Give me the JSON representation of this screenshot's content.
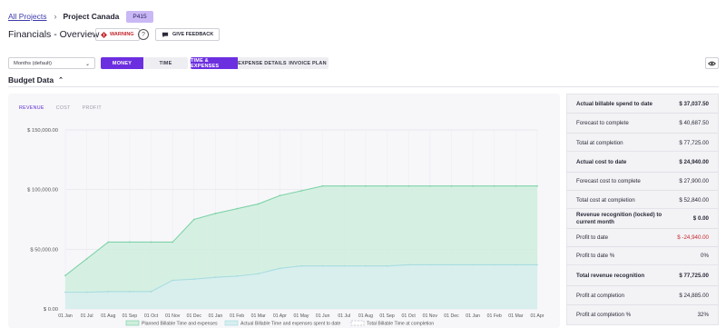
{
  "breadcrumb": {
    "root": "All Projects",
    "project": "Project Canada",
    "code": "P415"
  },
  "header": {
    "title": "Financials - Overview",
    "warning_label": "WARNING",
    "help": "?",
    "feedback_label": "GIVE FEEDBACK"
  },
  "controls": {
    "period_select": "Months (default)",
    "view_toggle": [
      "MONEY",
      "TIME"
    ],
    "data_tabs": [
      "TIME & EXPENSES",
      "EXPENSE DETAILS",
      "INVOICE PLAN"
    ]
  },
  "section": {
    "title": "Budget Data"
  },
  "chart_tabs": [
    "REVENUE",
    "COST",
    "PROFIT"
  ],
  "summary": [
    {
      "label": "Actual billable spend to date",
      "value": "$ 37,037.50"
    },
    {
      "label": "Forecast to complete",
      "value": "$ 40,687.50"
    },
    {
      "label": "Total at completion",
      "value": "$ 77,725.00"
    },
    {
      "label": "Actual cost to date",
      "value": "$ 24,940.00"
    },
    {
      "label": "Forecast cost to complete",
      "value": "$ 27,900.00"
    },
    {
      "label": "Total cost at completion",
      "value": "$ 52,840.00"
    },
    {
      "label": "Revenue recognition (locked) to current month",
      "value": "$ 0.00"
    },
    {
      "label": "Profit to date",
      "value": "$ -24,940.00"
    },
    {
      "label": "Profit to date %",
      "value": "0%"
    },
    {
      "label": "Total revenue recognition",
      "value": "$ 77,725.00"
    },
    {
      "label": "Profit at completion",
      "value": "$ 24,885.00"
    },
    {
      "label": "Profit at completion %",
      "value": "32%"
    }
  ],
  "colors": {
    "accent": "#6c2fe0",
    "planned": "#7fd3a8",
    "actual": "#a8dce0",
    "negative": "#c4282e"
  },
  "chart_data": {
    "type": "area",
    "x": [
      "01 Jan",
      "01 Jul",
      "01 Aug",
      "01 Sep",
      "01 Oct",
      "01 Nov",
      "01 Dec",
      "01 Jan",
      "01 Feb",
      "01 Mar",
      "01 Apr",
      "01 May",
      "01 Jun",
      "01 Jul",
      "01 Aug",
      "01 Sep",
      "01 Oct",
      "01 Nov",
      "01 Dec",
      "01 Jan",
      "01 Feb",
      "01 Mar",
      "01 Apr"
    ],
    "y_ticks": [
      "$ 0.00",
      "$ 50,000.00",
      "$ 100,000.00",
      "$ 150,000.00"
    ],
    "ylim": [
      0,
      150000
    ],
    "series": [
      {
        "name": "Planned Billable Time and expenses",
        "values": [
          28000,
          42000,
          56000,
          56000,
          56000,
          56000,
          75000,
          80000,
          84000,
          88000,
          95000,
          99000,
          103000,
          103000,
          103000,
          103000,
          103000,
          103000,
          103000,
          103000,
          103000,
          103000,
          103000
        ]
      },
      {
        "name": "Actual Billable Time and expenses spent to date",
        "values": [
          14000,
          14000,
          14500,
          14500,
          14500,
          24000,
          25000,
          26500,
          27500,
          29500,
          34000,
          36000,
          36000,
          36000,
          36000,
          36000,
          37000,
          37000,
          37000,
          37000,
          37000,
          37000,
          37000
        ]
      },
      {
        "name": "Total Billable Time at completion",
        "values": []
      }
    ],
    "legend_position": "bottom",
    "grid": true
  }
}
